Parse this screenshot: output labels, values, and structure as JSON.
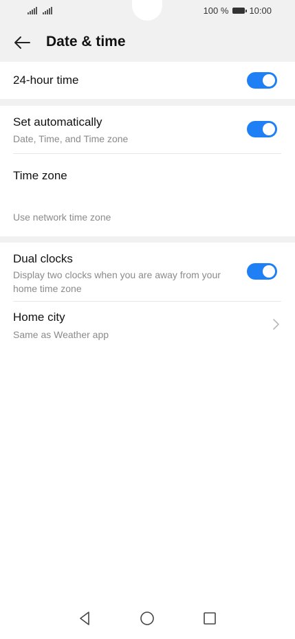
{
  "status_bar": {
    "battery": "100 %",
    "time": "10:00"
  },
  "header": {
    "title": "Date & time"
  },
  "settings": {
    "hour24": {
      "label": "24-hour time",
      "enabled": true
    },
    "set_auto": {
      "label": "Set automatically",
      "sub": "Date, Time, and Time zone",
      "enabled": true
    },
    "time_zone": {
      "label": "Time zone",
      "sub": "Use network time zone"
    },
    "dual_clocks": {
      "label": "Dual clocks",
      "sub": "Display two clocks when you are away from your home time zone",
      "enabled": true
    },
    "home_city": {
      "label": "Home city",
      "sub": "Same as Weather app"
    }
  },
  "icons": {
    "back": "back-arrow-icon",
    "chevron": "chevron-right-icon",
    "nav_back": "triangle-back-icon",
    "nav_home": "circle-home-icon",
    "nav_recent": "square-recents-icon"
  },
  "colors": {
    "accent": "#1f7ff5",
    "background": "#ffffff",
    "section_gap": "#f1f1f1"
  }
}
